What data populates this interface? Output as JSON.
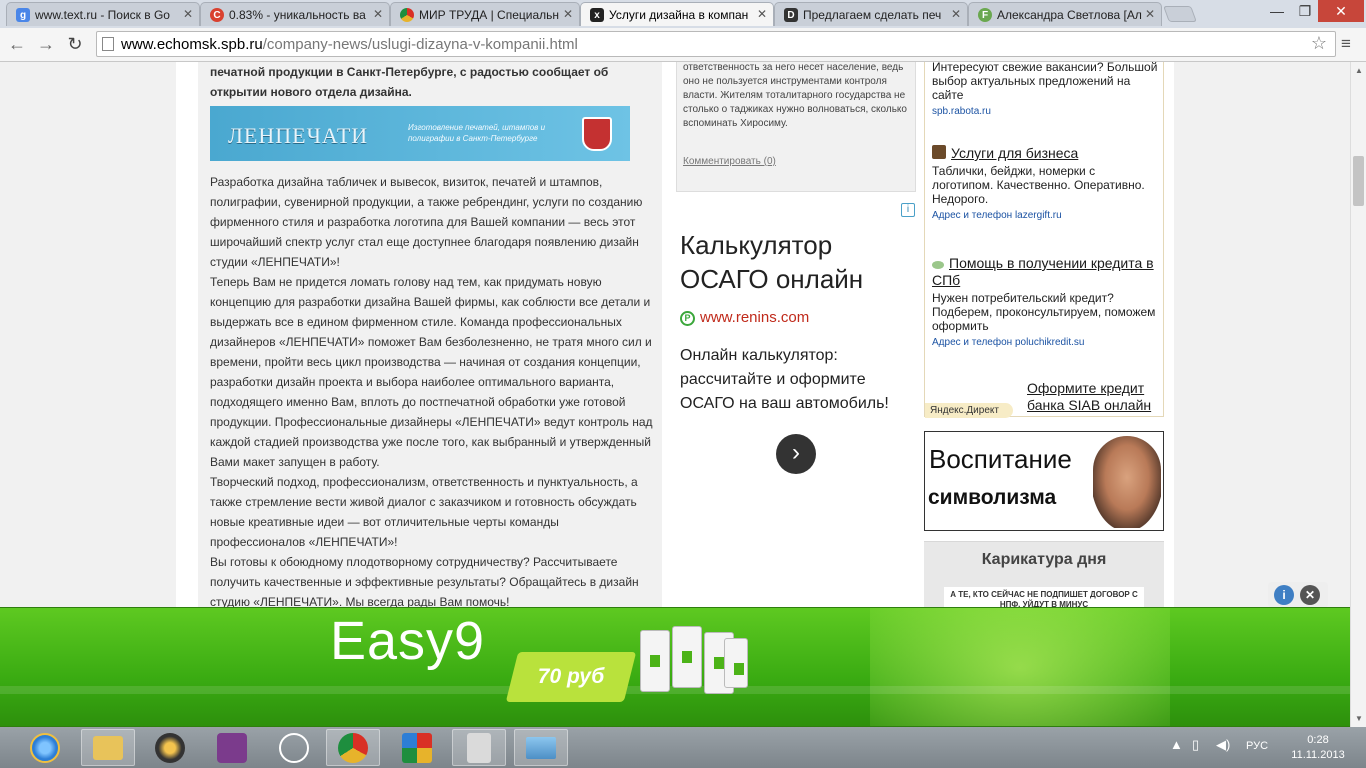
{
  "browser": {
    "tabs": [
      {
        "title": "www.text.ru - Поиск в Go",
        "icon": "google-search-icon",
        "color": "#4a86e8",
        "glyph": "g"
      },
      {
        "title": "0.83% - уникальность ва",
        "icon": "textru-icon",
        "color": "#d9412f",
        "glyph": "C"
      },
      {
        "title": "МИР ТРУДА | Специальн",
        "icon": "chrome-icon",
        "color": "#e7b32b",
        "glyph": ""
      },
      {
        "title": "Услуги дизайна в компан",
        "icon": "echomsk-icon",
        "color": "#222222",
        "glyph": "x"
      },
      {
        "title": "Предлагаем сделать печ",
        "icon": "id-icon",
        "color": "#333333",
        "glyph": "D"
      },
      {
        "title": "Александра Светлова [Ал",
        "icon": "fl-icon",
        "color": "#6aa84f",
        "glyph": "F"
      }
    ],
    "url_host": "www.echomsk.spb.ru",
    "url_path": "/company-news/uslugi-dizayna-v-kompanii.html",
    "window_controls": {
      "minimize": "—",
      "maximize": "❐",
      "close": "✕"
    },
    "nav": {
      "back": "←",
      "forward": "→",
      "reload": "↻",
      "star": "☆",
      "menu": "≡"
    }
  },
  "article": {
    "lead": "печатной продукции в Санкт-Петербурге, с радостью сообщает об открытии нового отдела дизайна.",
    "banner": {
      "logo_text": "ЛЕНПЕЧАТИ",
      "tagline": "Изготовление печатей, штампов и полиграфии в Санкт-Петербурге"
    },
    "paragraphs": [
      "Разработка дизайна табличек и вывесок, визиток, печатей и штампов, полиграфии, сувенирной продукции, а также ребрендинг, услуги по созданию фирменного стиля и разработка логотипа для Вашей компании — весь этот широчайший спектр услуг стал еще доступнее благодаря появлению дизайн студии «ЛЕНПЕЧАТИ»!",
      "Теперь Вам не придется ломать голову над тем, как придумать новую концепцию для разработки дизайна Вашей фирмы, как соблюсти все детали и выдержать все в едином фирменном стиле. Команда профессиональных дизайнеров «ЛЕНПЕЧАТИ» поможет Вам безболезненно, не тратя много сил и времени, пройти весь цикл производства — начиная от создания концепции, разработки дизайн проекта и выбора наиболее оптимального варианта, подходящего именно Вам, вплоть до постпечатной обработки уже готовой продукции. Профессиональные дизайнеры «ЛЕНПЕЧАТИ» ведут контроль над каждой стадией производства уже после того, как выбранный и утвержденный Вами макет запущен в работу.",
      "Творческий подход, профессионализм, ответственность и пунктуальность, а также стремление вести живой диалог с заказчиком и готовность обсуждать новые креативные идеи — вот отличительные черты команды профессионалов «ЛЕНПЕЧАТИ»!",
      "Вы готовы к обоюдному плодотворному сотрудничеству? Рассчитываете получить качественные и эффективные результаты? Обращайтесь в дизайн студию «ЛЕНПЕЧАТИ». Мы всегда рады Вам помочь!"
    ]
  },
  "middle": {
    "snippet": "ответственность за него несет население, ведь оно не пользуется инструментами контроля власти. Жителям тоталитарного государства не столько о таджиках нужно волноваться, сколько вспоминать Хиросиму.",
    "comment_link": "Комментировать (0)",
    "ad_info": "i",
    "ad": {
      "title": "Калькулятор ОСАГО онлайн",
      "domain_icon": "Р",
      "domain": "www.renins.com",
      "desc": "Онлайн калькулятор: рассчитайте и оформите ОСАГО на ваш автомобиль!",
      "next": "›"
    }
  },
  "direct": {
    "items": [
      {
        "title": "",
        "text": "Интересуют свежие вакансии? Большой выбор актуальных предложений на сайте",
        "contact": "spb.rabota.ru",
        "icon": ""
      },
      {
        "title": "Услуги для бизнеса",
        "text": "Таблички, бейджи, номерки с логотипом. Качественно. Оперативно. Недорого.",
        "contact": "Адрес и телефон  lazergift.ru",
        "icon": "lazergift-icon"
      },
      {
        "title": "Помощь в получении кредита в СПб",
        "text": "Нужен потребительский кредит? Подберем, проконсультируем, поможем оформить",
        "contact": "Адрес и телефон  poluchikredit.su",
        "icon": "credit-icon"
      }
    ],
    "label": "Яндекс.Директ",
    "siab": "Оформите кредит банка SIAB онлайн"
  },
  "promo": {
    "line1": "Воспитание",
    "line2": "символизма"
  },
  "cartoon": {
    "title": "Карикатура дня",
    "caption": "А ТЕ, КТО СЕЙЧАС НЕ ПОДПИШЕТ ДОГОВОР С НПФ, УЙДУТ В МИНУС"
  },
  "overlay": {
    "info": "i",
    "close": "✕"
  },
  "bottom_banner": {
    "brand": "Easy9",
    "price": "70 руб"
  },
  "taskbar": {
    "apps": [
      {
        "name": "ie-icon",
        "color": "#2d7ed6"
      },
      {
        "name": "explorer-icon",
        "color": "#e8c35a"
      },
      {
        "name": "media-player-icon",
        "color": "#d99a1e"
      },
      {
        "name": "wifi-app-icon",
        "color": "#7b3b8c"
      },
      {
        "name": "hp-icon",
        "color": "#ffffff"
      },
      {
        "name": "chrome-icon",
        "color": "#e0a72c"
      },
      {
        "name": "puzzle-icon",
        "color": "#2e2e2e"
      },
      {
        "name": "clipboard-icon",
        "color": "#dadada"
      },
      {
        "name": "photo-viewer-icon",
        "color": "#4d8fc6"
      }
    ],
    "lang": "РУС",
    "time": "0:28",
    "date": "11.11.2013"
  }
}
